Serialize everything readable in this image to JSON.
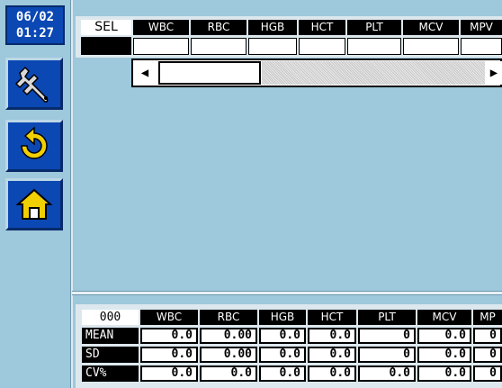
{
  "clock": {
    "date": "06/02",
    "time": "01:27"
  },
  "sidebar": [
    {
      "icon": "wrench-icon"
    },
    {
      "icon": "refresh-icon"
    },
    {
      "icon": "home-icon"
    }
  ],
  "top_table": {
    "sel_label": "SEL",
    "columns": [
      "WBC",
      "RBC",
      "HGB",
      "HCT",
      "PLT",
      "MCV",
      "MPV"
    ]
  },
  "scrollbar": {
    "left_arrow": "◀",
    "right_arrow": "▶"
  },
  "stats": {
    "id_label": "000",
    "columns": [
      "WBC",
      "RBC",
      "HGB",
      "HCT",
      "PLT",
      "MCV",
      "MP"
    ],
    "rows": [
      {
        "label": "MEAN",
        "values": [
          "0.0",
          "0.00",
          "0.0",
          "0.0",
          "0",
          "0.0",
          "0"
        ]
      },
      {
        "label": "SD",
        "values": [
          "0.0",
          "0.00",
          "0.0",
          "0.0",
          "0",
          "0.0",
          "0"
        ]
      },
      {
        "label": "CV%",
        "values": [
          "0.0",
          "0.0",
          "0.0",
          "0.0",
          "0.0",
          "0.0",
          "0"
        ]
      }
    ]
  },
  "colors": {
    "background": "#9ec8db",
    "button": "#0c48b4",
    "header": "#000000",
    "cell": "#ffffff"
  }
}
